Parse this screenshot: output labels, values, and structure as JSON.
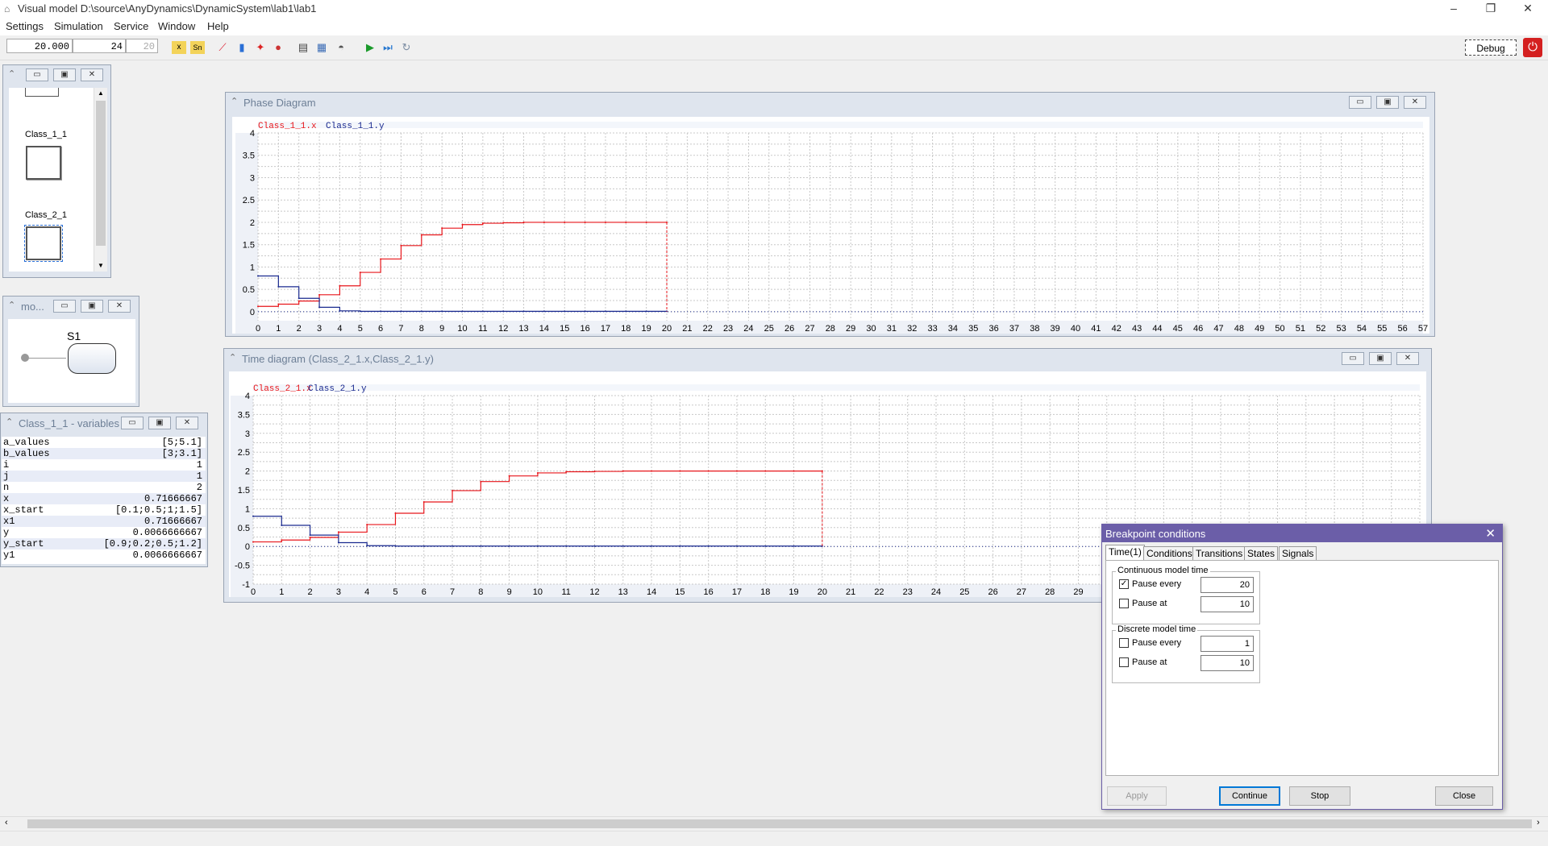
{
  "window": {
    "title": "Visual model D:\\source\\AnyDynamics\\DynamicSystem\\lab1\\lab1",
    "controls": [
      "–",
      "❐",
      "✕"
    ]
  },
  "menu": [
    "Settings",
    "Simulation",
    "Service",
    "Window",
    "Help"
  ],
  "toolbar": {
    "time_value": "20.000",
    "step_value": "24",
    "disabled_value": "20",
    "debug_label": "Debug"
  },
  "class_panel": {
    "items": [
      "Class_1_1",
      "Class_2_1"
    ]
  },
  "state_panel": {
    "title": "mo...",
    "state_label": "S1"
  },
  "variables_panel": {
    "title": "Class_1_1 - variables",
    "rows": [
      {
        "name": "a_values",
        "value": "[5;5.1]"
      },
      {
        "name": "b_values",
        "value": "[3;3.1]"
      },
      {
        "name": "i",
        "value": "1"
      },
      {
        "name": "j",
        "value": "1"
      },
      {
        "name": "n",
        "value": "2"
      },
      {
        "name": "x",
        "value": "0.71666667"
      },
      {
        "name": "x_start",
        "value": "[0.1;0.5;1;1.5]"
      },
      {
        "name": "x1",
        "value": "0.71666667"
      },
      {
        "name": "y",
        "value": "0.0066666667"
      },
      {
        "name": "y_start",
        "value": "[0.9;0.2;0.5;1.2]"
      },
      {
        "name": "y1",
        "value": "0.0066666667"
      }
    ]
  },
  "phase_window": {
    "title": "Phase Diagram"
  },
  "time_window": {
    "title": "Time diagram (Class_2_1.x,Class_2_1.y)"
  },
  "chart_data": [
    {
      "type": "line",
      "title": "Phase Diagram",
      "series": [
        {
          "name": "Class_1_1.x",
          "color": "#e8161b",
          "x": [
            0,
            1,
            2,
            3,
            4,
            5,
            6,
            7,
            8,
            9,
            10,
            11,
            12,
            13,
            14,
            15,
            16,
            17,
            18,
            19,
            20
          ],
          "y": [
            0.12,
            0.17,
            0.24,
            0.38,
            0.58,
            0.88,
            1.18,
            1.48,
            1.72,
            1.87,
            1.95,
            1.98,
            1.99,
            2.0,
            2.0,
            2.0,
            2.0,
            2.0,
            2.0,
            2.0,
            2.0
          ]
        },
        {
          "name": "Class_1_1.y",
          "color": "#1a2a8f",
          "x": [
            0,
            1,
            2,
            3,
            4,
            5,
            6,
            7,
            8,
            9,
            10,
            11,
            12,
            13,
            14,
            15,
            16,
            17,
            18,
            19,
            20
          ],
          "y": [
            0.8,
            0.56,
            0.3,
            0.1,
            0.02,
            0.01,
            0.01,
            0.01,
            0.01,
            0.01,
            0.01,
            0.01,
            0.01,
            0.01,
            0.01,
            0.01,
            0.01,
            0.01,
            0.01,
            0.01,
            0.01
          ]
        }
      ],
      "xlim": [
        0,
        57
      ],
      "ylim": [
        -0.2,
        4
      ],
      "xticks": [
        0,
        1,
        2,
        3,
        4,
        5,
        6,
        7,
        8,
        9,
        10,
        11,
        12,
        13,
        14,
        15,
        16,
        17,
        18,
        19,
        20,
        21,
        22,
        23,
        24,
        25,
        26,
        27,
        28,
        29,
        30,
        31,
        32,
        33,
        34,
        35,
        36,
        37,
        38,
        39,
        40,
        41,
        42,
        43,
        44,
        45,
        46,
        47,
        48,
        49,
        50,
        51,
        52,
        53,
        54,
        55,
        56,
        57
      ],
      "yticks": [
        "0",
        "0.5",
        "1",
        "1.5",
        "2",
        "2.5",
        "3",
        "3.5",
        "4"
      ],
      "grid": true
    },
    {
      "type": "line",
      "title": "Time diagram (Class_2_1.x,Class_2_1.y)",
      "series": [
        {
          "name": "Class_2_1.x",
          "color": "#e8161b",
          "x": [
            0,
            1,
            2,
            3,
            4,
            5,
            6,
            7,
            8,
            9,
            10,
            11,
            12,
            13,
            14,
            15,
            16,
            17,
            18,
            19,
            20
          ],
          "y": [
            0.12,
            0.17,
            0.24,
            0.38,
            0.58,
            0.88,
            1.18,
            1.48,
            1.72,
            1.87,
            1.95,
            1.98,
            1.99,
            2.0,
            2.0,
            2.0,
            2.0,
            2.0,
            2.0,
            2.0,
            2.0
          ]
        },
        {
          "name": "Class_2_1.y",
          "color": "#1a2a8f",
          "x": [
            0,
            1,
            2,
            3,
            4,
            5,
            6,
            7,
            8,
            9,
            10,
            11,
            12,
            13,
            14,
            15,
            16,
            17,
            18,
            19,
            20
          ],
          "y": [
            0.8,
            0.56,
            0.3,
            0.1,
            0.02,
            0.01,
            0.01,
            0.01,
            0.01,
            0.01,
            0.01,
            0.01,
            0.01,
            0.01,
            0.01,
            0.01,
            0.01,
            0.01,
            0.01,
            0.01,
            0.01
          ]
        }
      ],
      "xlim": [
        0,
        41
      ],
      "ylim": [
        -1,
        4
      ],
      "xticks": [
        0,
        1,
        2,
        3,
        4,
        5,
        6,
        7,
        8,
        9,
        10,
        11,
        12,
        13,
        14,
        15,
        16,
        17,
        18,
        19,
        20,
        21,
        22,
        23,
        24,
        25,
        26,
        27,
        28,
        29,
        30,
        31,
        32,
        33,
        34,
        35,
        36,
        37,
        38,
        39,
        40,
        41
      ],
      "yticks": [
        "-1",
        "-0.5",
        "0",
        "0.5",
        "1",
        "1.5",
        "2",
        "2.5",
        "3",
        "3.5",
        "4"
      ],
      "grid": true
    }
  ],
  "dialog": {
    "title": "Breakpoint conditions",
    "tabs": [
      "Time(1)",
      "Conditions",
      "Transitions",
      "States",
      "Signals"
    ],
    "continuous": {
      "label": "Continuous model time",
      "pause_every_label": "Pause every",
      "pause_every_checked": true,
      "pause_every_value": "20",
      "pause_at_label": "Pause at",
      "pause_at_checked": false,
      "pause_at_value": "10"
    },
    "discrete": {
      "label": "Discrete model time",
      "pause_every_label": "Pause every",
      "pause_every_checked": false,
      "pause_every_value": "1",
      "pause_at_label": "Pause at",
      "pause_at_checked": false,
      "pause_at_value": "10"
    },
    "buttons": {
      "apply": "Apply",
      "continue": "Continue",
      "stop": "Stop",
      "close": "Close"
    }
  }
}
